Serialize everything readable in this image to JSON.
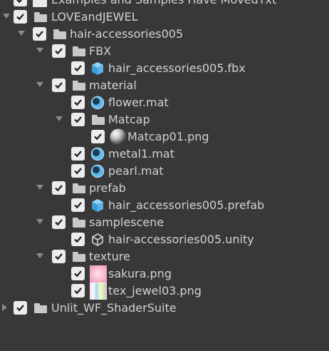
{
  "tree": {
    "top_partial_label": "Examples and Samples Have MovedTxt",
    "root_label": "LOVEandJEWEL",
    "package_label": "hair-accessories005",
    "fbx_folder": "FBX",
    "fbx_file": "hair_accessories005.fbx",
    "material_folder": "material",
    "flower_mat": "flower.mat",
    "matcap_folder": "Matcap",
    "matcap_png": "Matcap01.png",
    "metal_mat": "metal1.mat",
    "pearl_mat": "pearl.mat",
    "prefab_folder": "prefab",
    "prefab_file": "hair_accessories005.prefab",
    "samplescene_folder": "samplescene",
    "unity_file": "hair-accessories005.unity",
    "texture_folder": "texture",
    "sakura_png": "sakura.png",
    "jewel_png": "tex_jewel03.png",
    "shader_suite": "Unlit_WF_ShaderSuite"
  },
  "colors": {
    "background": "#383838",
    "text": "#d2d2d2",
    "checkbox": "#ececec",
    "material_sphere": "#5fb8e8",
    "prefab_cube": "#5ab2e6"
  }
}
